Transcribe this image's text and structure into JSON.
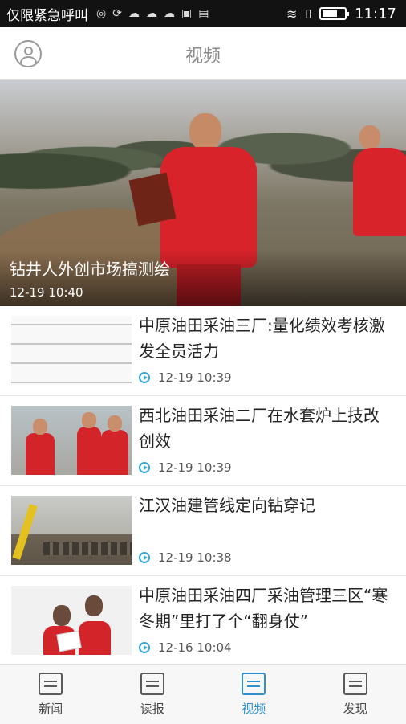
{
  "status_bar": {
    "carrier": "仅限紧急呼叫",
    "time": "11:17",
    "icons": [
      "app-icon",
      "sync-icon",
      "cloud-icon",
      "cloud-icon",
      "cloud-icon",
      "lock-icon",
      "sim-icon",
      "wifi-icon",
      "signal-icon",
      "battery-icon"
    ]
  },
  "header": {
    "title": "视频"
  },
  "hero": {
    "caption": "钻井人外创市场搞测绘",
    "time": "12-19 10:40"
  },
  "items": [
    {
      "title": "中原油田采油三厂:量化绩效考核激发全员活力",
      "time": "12-19 10:39"
    },
    {
      "title": "西北油田采油二厂在水套炉上技改创效",
      "time": "12-19 10:39"
    },
    {
      "title": "江汉油建管线定向钻穿记",
      "time": "12-19 10:38"
    },
    {
      "title": "中原油田采油四厂采油管理三区“寒冬期”里打了个“翻身仗”",
      "time": "12-16 10:04"
    }
  ],
  "bottom_nav": [
    {
      "label": "新闻",
      "icon": "news-icon",
      "active": false
    },
    {
      "label": "读报",
      "icon": "newspaper-icon",
      "active": false
    },
    {
      "label": "视频",
      "icon": "video-icon",
      "active": true
    },
    {
      "label": "发现",
      "icon": "discover-icon",
      "active": false
    }
  ],
  "colors": {
    "accent": "#2f8fd0",
    "play": "#35a6d8",
    "status_bar": "#121212"
  }
}
